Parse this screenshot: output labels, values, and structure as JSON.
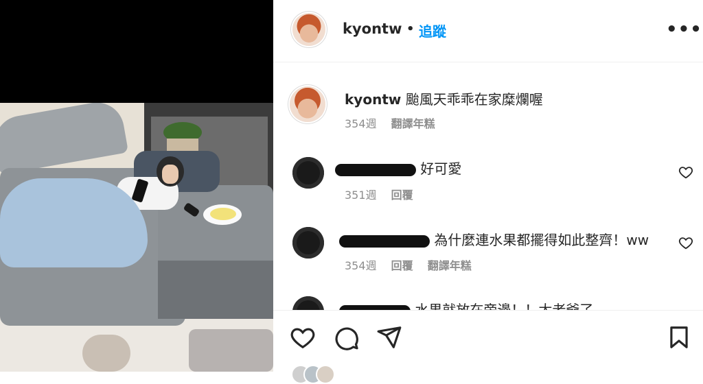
{
  "post": {
    "username": "kyontw",
    "separator": "•",
    "follow_label": "追蹤",
    "more_label": "•••",
    "caption": {
      "username": "kyontw",
      "text": "颱風天乖乖在家糜爛喔",
      "time": "354週",
      "translate_label": "翻譯年糕"
    }
  },
  "comments": [
    {
      "text": "好可愛",
      "time": "351週",
      "reply_label": "回覆",
      "translate_label": ""
    },
    {
      "text": "為什麼連水果都擺得如此整齊！ww",
      "time": "354週",
      "reply_label": "回覆",
      "translate_label": "翻譯年糕"
    },
    {
      "text": "水果就放在旁邊！！太老爺了。"
    }
  ],
  "icons": {
    "like": "heart-icon",
    "comment": "comment-icon",
    "share": "send-icon",
    "save": "bookmark-icon",
    "more": "more-icon"
  },
  "colors": {
    "follow": "#0095f6",
    "text": "#262626",
    "muted": "#8e8e8e"
  }
}
